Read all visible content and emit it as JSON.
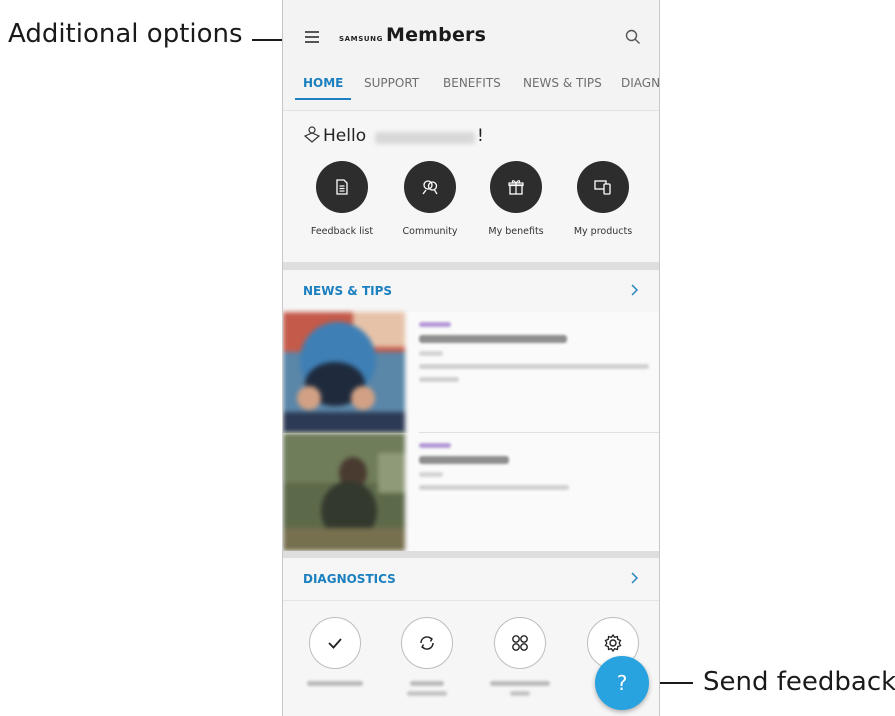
{
  "callouts": {
    "left": "Additional options",
    "right": "Send feedback."
  },
  "app": {
    "brand_small": "SAMSUNG",
    "brand_large": "Members"
  },
  "tabs": [
    {
      "label": "HOME",
      "active": true
    },
    {
      "label": "SUPPORT"
    },
    {
      "label": "BENEFITS"
    },
    {
      "label": "NEWS & TIPS"
    },
    {
      "label": "DIAGN"
    }
  ],
  "hello": {
    "greeting": "Hello",
    "suffix": "!"
  },
  "quick_actions": [
    {
      "label": "Feedback list",
      "icon": "document-icon"
    },
    {
      "label": "Community",
      "icon": "people-icon"
    },
    {
      "label": "My benefits",
      "icon": "gift-icon"
    },
    {
      "label": "My products",
      "icon": "devices-icon"
    }
  ],
  "news": {
    "title": "NEWS & TIPS",
    "accent": "#1c7fbf",
    "tag_color": "#b59ad8"
  },
  "diagnostics": {
    "title": "DIAGNOSTICS",
    "items": [
      {
        "icon": "checkmark-icon"
      },
      {
        "icon": "refresh-icon"
      },
      {
        "icon": "grid-circles-icon"
      },
      {
        "icon": "settings-gear-icon"
      }
    ]
  },
  "fab": {
    "label": "?",
    "color": "#29a3df"
  }
}
